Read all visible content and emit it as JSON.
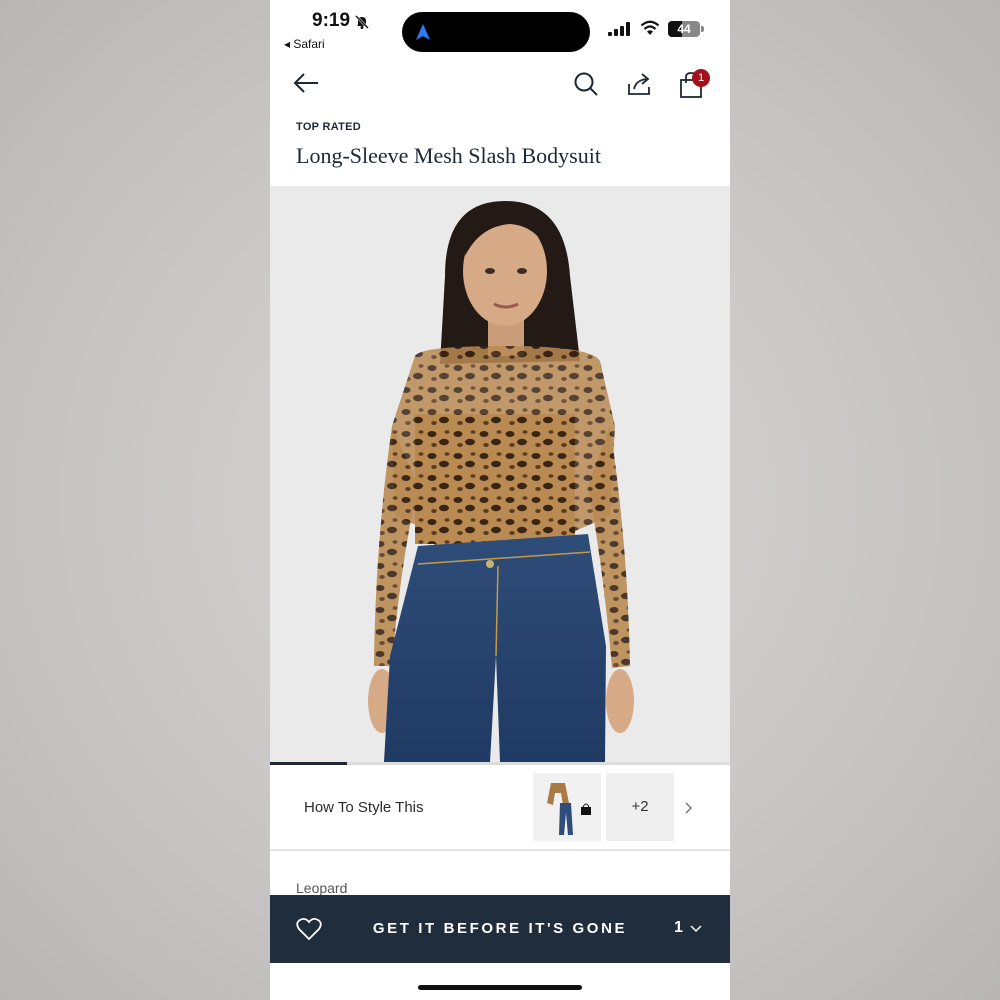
{
  "status_bar": {
    "time": "9:19",
    "back_app": "◂ Safari",
    "battery": "44",
    "battery_level": 0.44
  },
  "header": {
    "icons": [
      "back-arrow-icon",
      "search-icon",
      "share-icon",
      "shopping-bag-icon"
    ],
    "bag_count": "1"
  },
  "product": {
    "eyebrow": "TOP RATED",
    "title": "Long-Sleeve Mesh Slash Bodysuit",
    "color": "Leopard"
  },
  "gallery": {
    "progress": 0.167
  },
  "style": {
    "label": "How To Style This",
    "more": "+2"
  },
  "cta": {
    "label": "GET IT BEFORE IT'S GONE",
    "quantity": "1"
  },
  "colors": {
    "navy": "#1f2d3d",
    "badge": "#a4111d"
  }
}
